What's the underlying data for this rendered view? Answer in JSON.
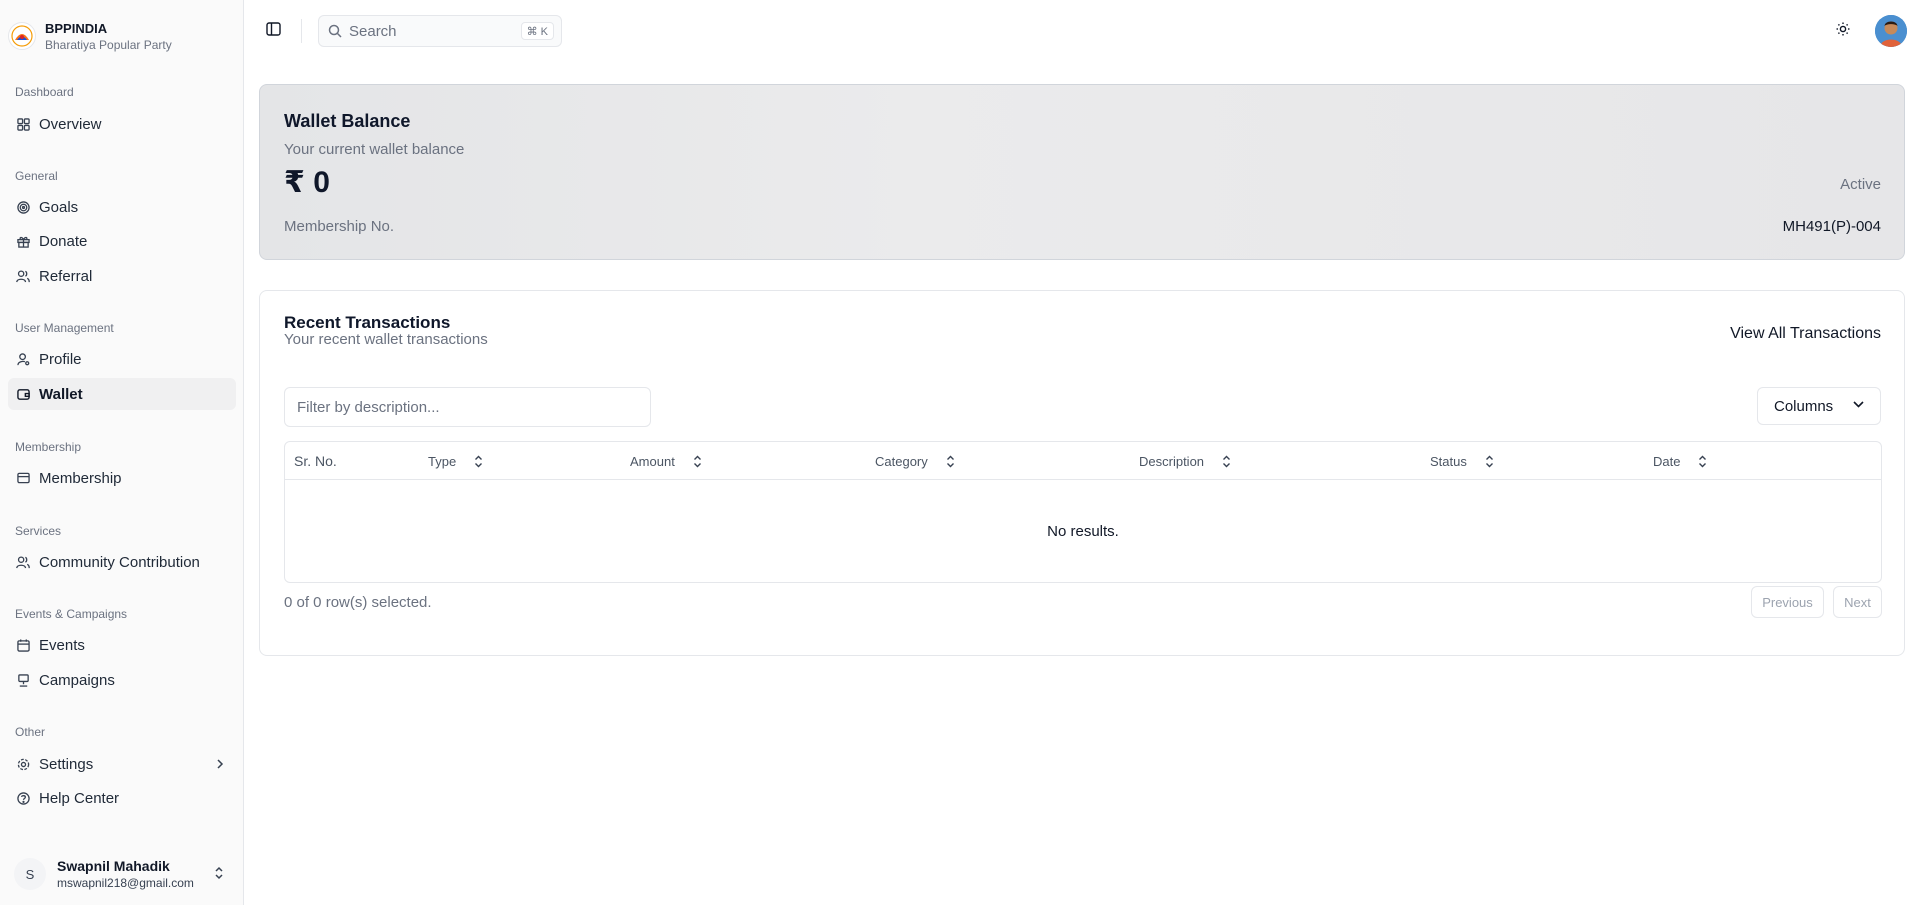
{
  "brand": {
    "name": "BPPINDIA",
    "subtitle": "Bharatiya Popular Party"
  },
  "sidebar": {
    "groups": [
      {
        "label": "Dashboard",
        "items": [
          {
            "label": "Overview",
            "icon": "grid-icon"
          }
        ]
      },
      {
        "label": "General",
        "items": [
          {
            "label": "Goals",
            "icon": "target-icon"
          },
          {
            "label": "Donate",
            "icon": "gift-icon"
          },
          {
            "label": "Referral",
            "icon": "users-icon"
          }
        ]
      },
      {
        "label": "User Management",
        "items": [
          {
            "label": "Profile",
            "icon": "user-cog-icon"
          },
          {
            "label": "Wallet",
            "icon": "wallet-icon",
            "active": true
          }
        ]
      },
      {
        "label": "Membership",
        "items": [
          {
            "label": "Membership",
            "icon": "card-icon"
          }
        ]
      },
      {
        "label": "Services",
        "items": [
          {
            "label": "Community Contribution",
            "icon": "users-icon"
          }
        ]
      },
      {
        "label": "Events & Campaigns",
        "items": [
          {
            "label": "Events",
            "icon": "calendar-icon"
          },
          {
            "label": "Campaigns",
            "icon": "presentation-icon"
          }
        ]
      },
      {
        "label": "Other",
        "items": [
          {
            "label": "Settings",
            "icon": "gear-icon"
          },
          {
            "label": "Help Center",
            "icon": "help-circle-icon"
          }
        ]
      }
    ]
  },
  "user": {
    "initial": "S",
    "name": "Swapnil Mahadik",
    "email": "mswapnil218@gmail.com"
  },
  "topbar": {
    "search_placeholder": "Search",
    "shortcut": "⌘ K"
  },
  "wallet": {
    "title": "Wallet Balance",
    "subtitle": "Your current wallet balance",
    "amount": "₹ 0",
    "status": "Active",
    "membership_label": "Membership No.",
    "membership_no": "MH491(P)-004"
  },
  "transactions": {
    "title": "Recent Transactions",
    "subtitle": "Your recent wallet transactions",
    "view_all": "View All Transactions",
    "filter_placeholder": "Filter by description...",
    "columns_label": "Columns",
    "headers": [
      "Sr. No.",
      "Type",
      "Amount",
      "Category",
      "Description",
      "Status",
      "Date"
    ],
    "empty": "No results.",
    "selected": "0 of 0 row(s) selected.",
    "prev": "Previous",
    "next": "Next"
  },
  "colors": {
    "wallet_card_bg": "#e6e7e9",
    "accent_text": "#0f172a",
    "muted_text": "#6b7280"
  }
}
